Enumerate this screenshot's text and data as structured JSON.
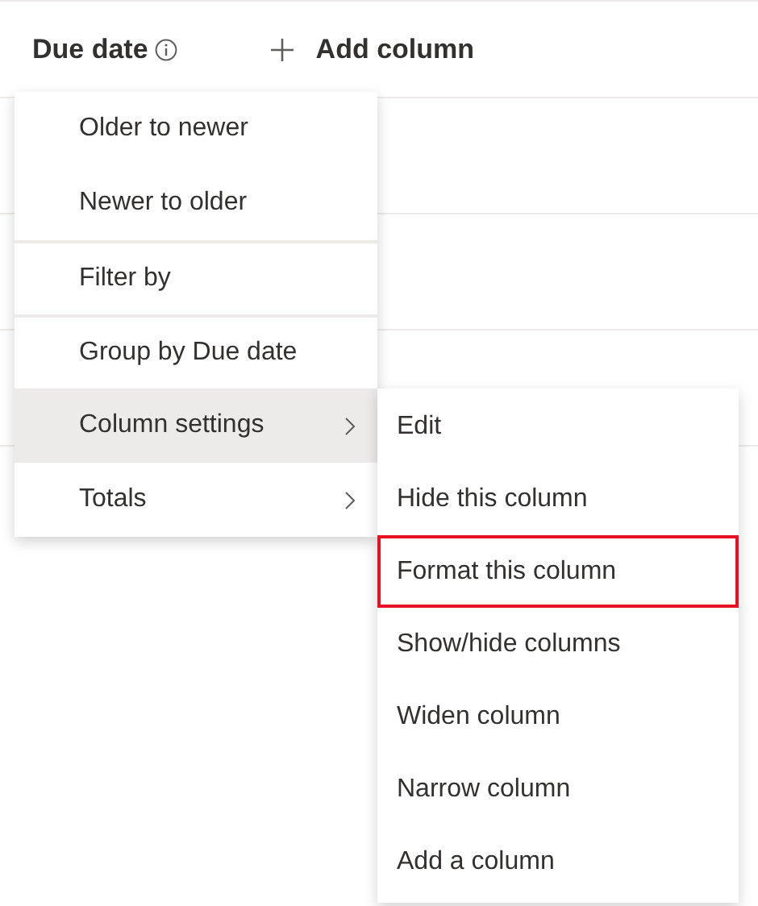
{
  "columns": [
    {
      "label": "Due date",
      "info": true
    },
    {
      "label": "Add column",
      "kind": "add"
    }
  ],
  "menu": {
    "items": [
      {
        "label": "Older to newer",
        "kind": "action",
        "selected": false,
        "separator_before": false
      },
      {
        "label": "Newer to older",
        "kind": "action",
        "selected": false,
        "separator_before": false
      },
      {
        "label": "Filter by",
        "kind": "action",
        "selected": false,
        "separator_before": true
      },
      {
        "label": "Group by Due date",
        "kind": "action",
        "selected": false,
        "separator_before": true
      },
      {
        "label": "Column settings",
        "kind": "submenu",
        "selected": true,
        "separator_before": false
      },
      {
        "label": "Totals",
        "kind": "submenu",
        "selected": false,
        "separator_before": false
      }
    ]
  },
  "submenu": {
    "items": [
      {
        "label": "Edit",
        "outlined": false
      },
      {
        "label": "Hide this column",
        "outlined": false
      },
      {
        "label": "Format this column",
        "outlined": true
      },
      {
        "label": "Show/hide columns",
        "outlined": false
      },
      {
        "label": "Widen column",
        "outlined": false
      },
      {
        "label": "Narrow column",
        "outlined": false
      },
      {
        "label": "Add a column",
        "outlined": false
      }
    ]
  }
}
